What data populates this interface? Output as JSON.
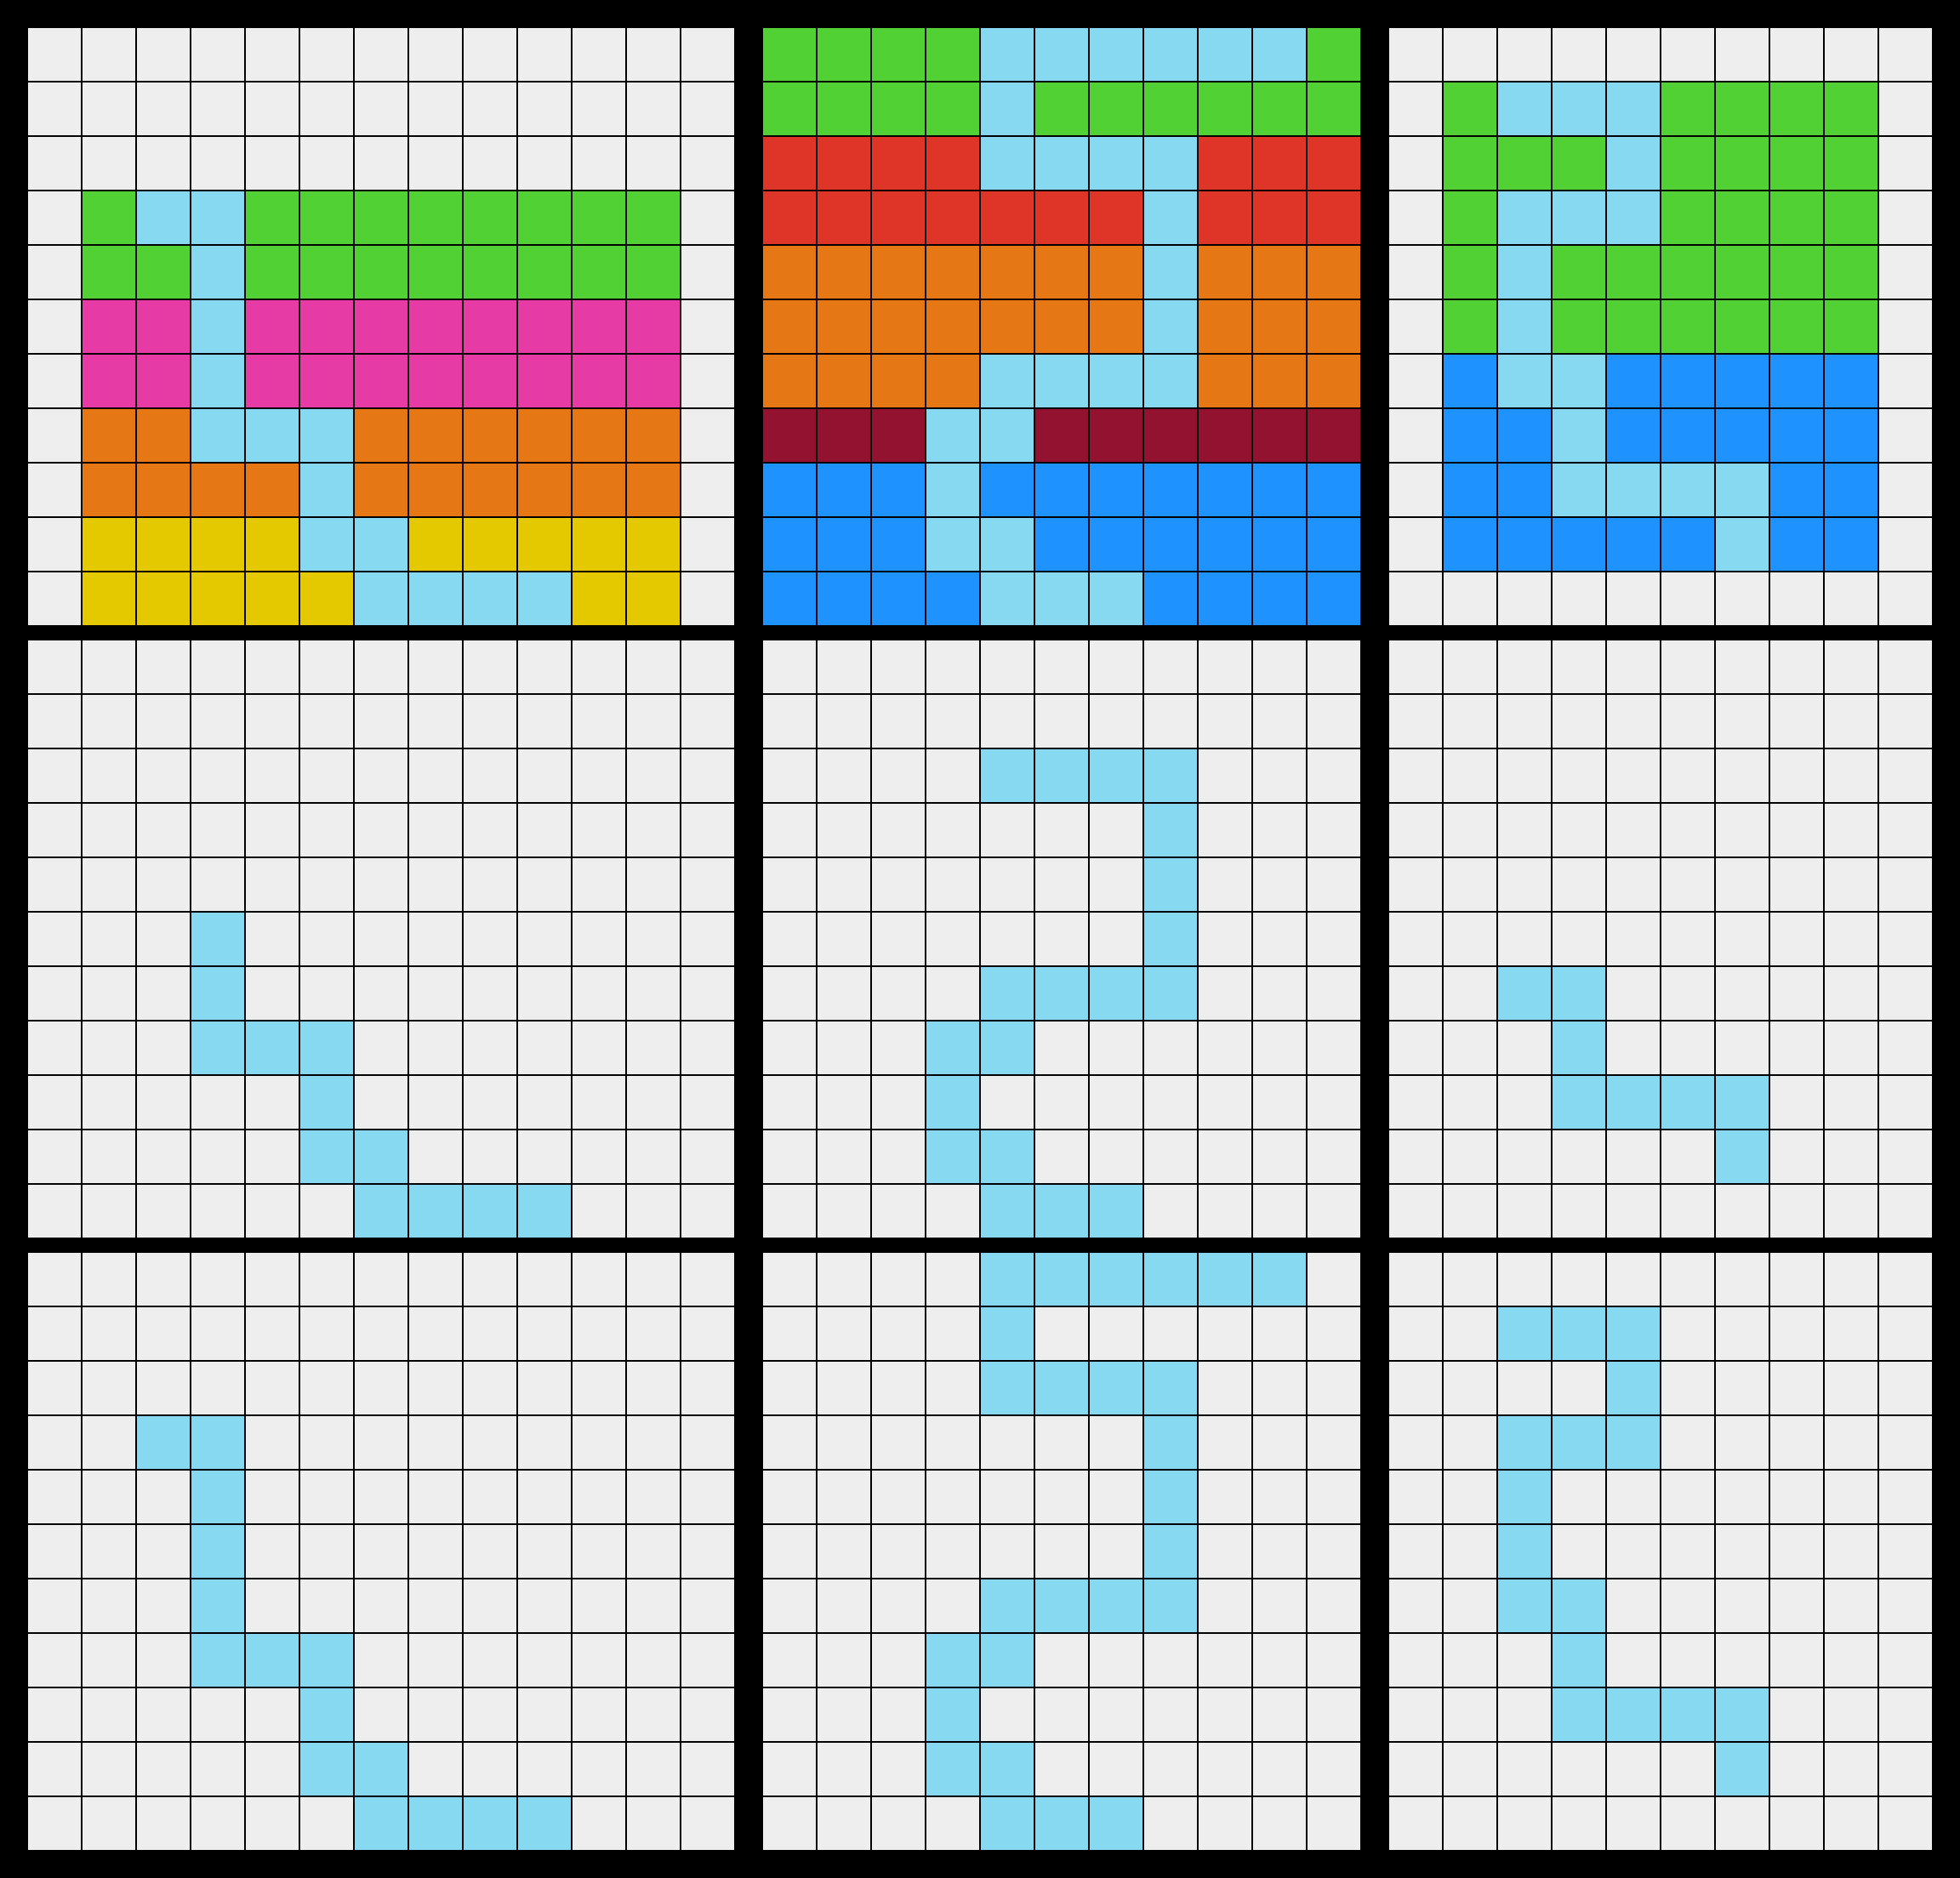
{
  "colors": {
    "0": "#EEEEEE",
    "1": "#51D133",
    "2": "#87D9F2",
    "3": "#E63BA4",
    "4": "#E57715",
    "5": "#E5C900",
    "6": "#DF3428",
    "7": "#921230",
    "8": "#1E92FF"
  },
  "panels": [
    {
      "name": "panel-r1-c1",
      "rows": 11,
      "cols": 13,
      "grid": [
        [
          0,
          0,
          0,
          0,
          0,
          0,
          0,
          0,
          0,
          0,
          0,
          0,
          0
        ],
        [
          0,
          0,
          0,
          0,
          0,
          0,
          0,
          0,
          0,
          0,
          0,
          0,
          0
        ],
        [
          0,
          0,
          0,
          0,
          0,
          0,
          0,
          0,
          0,
          0,
          0,
          0,
          0
        ],
        [
          0,
          1,
          2,
          2,
          1,
          1,
          1,
          1,
          1,
          1,
          1,
          1,
          0
        ],
        [
          0,
          1,
          1,
          2,
          1,
          1,
          1,
          1,
          1,
          1,
          1,
          1,
          0
        ],
        [
          0,
          3,
          3,
          2,
          3,
          3,
          3,
          3,
          3,
          3,
          3,
          3,
          0
        ],
        [
          0,
          3,
          3,
          2,
          3,
          3,
          3,
          3,
          3,
          3,
          3,
          3,
          0
        ],
        [
          0,
          4,
          4,
          2,
          2,
          2,
          4,
          4,
          4,
          4,
          4,
          4,
          0
        ],
        [
          0,
          4,
          4,
          4,
          4,
          2,
          4,
          4,
          4,
          4,
          4,
          4,
          0
        ],
        [
          0,
          5,
          5,
          5,
          5,
          2,
          2,
          5,
          5,
          5,
          5,
          5,
          0
        ],
        [
          0,
          5,
          5,
          5,
          5,
          5,
          2,
          2,
          2,
          2,
          5,
          5,
          0
        ]
      ]
    },
    {
      "name": "panel-r1-c2",
      "rows": 11,
      "cols": 11,
      "grid": [
        [
          1,
          1,
          1,
          1,
          2,
          2,
          2,
          2,
          2,
          2,
          1
        ],
        [
          1,
          1,
          1,
          1,
          2,
          1,
          1,
          1,
          1,
          1,
          1
        ],
        [
          6,
          6,
          6,
          6,
          2,
          2,
          2,
          2,
          6,
          6,
          6
        ],
        [
          6,
          6,
          6,
          6,
          6,
          6,
          6,
          2,
          6,
          6,
          6
        ],
        [
          4,
          4,
          4,
          4,
          4,
          4,
          4,
          2,
          4,
          4,
          4
        ],
        [
          4,
          4,
          4,
          4,
          4,
          4,
          4,
          2,
          4,
          4,
          4
        ],
        [
          4,
          4,
          4,
          4,
          2,
          2,
          2,
          2,
          4,
          4,
          4
        ],
        [
          7,
          7,
          7,
          2,
          2,
          7,
          7,
          7,
          7,
          7,
          7
        ],
        [
          8,
          8,
          8,
          2,
          8,
          8,
          8,
          8,
          8,
          8,
          8
        ],
        [
          8,
          8,
          8,
          2,
          2,
          8,
          8,
          8,
          8,
          8,
          8
        ],
        [
          8,
          8,
          8,
          8,
          2,
          2,
          2,
          8,
          8,
          8,
          8
        ]
      ]
    },
    {
      "name": "panel-r1-c3",
      "rows": 11,
      "cols": 10,
      "grid": [
        [
          0,
          0,
          0,
          0,
          0,
          0,
          0,
          0,
          0,
          0
        ],
        [
          0,
          1,
          2,
          2,
          2,
          1,
          1,
          1,
          1,
          0
        ],
        [
          0,
          1,
          1,
          1,
          2,
          1,
          1,
          1,
          1,
          0
        ],
        [
          0,
          1,
          2,
          2,
          2,
          1,
          1,
          1,
          1,
          0
        ],
        [
          0,
          1,
          2,
          1,
          1,
          1,
          1,
          1,
          1,
          0
        ],
        [
          0,
          1,
          2,
          1,
          1,
          1,
          1,
          1,
          1,
          0
        ],
        [
          0,
          8,
          2,
          2,
          8,
          8,
          8,
          8,
          8,
          0
        ],
        [
          0,
          8,
          8,
          2,
          8,
          8,
          8,
          8,
          8,
          0
        ],
        [
          0,
          8,
          8,
          2,
          2,
          2,
          2,
          8,
          8,
          0
        ],
        [
          0,
          8,
          8,
          8,
          8,
          8,
          2,
          8,
          8,
          0
        ],
        [
          0,
          0,
          0,
          0,
          0,
          0,
          0,
          0,
          0,
          0
        ]
      ]
    },
    {
      "name": "panel-r2-c1",
      "rows": 11,
      "cols": 13,
      "grid": [
        [
          0,
          0,
          0,
          0,
          0,
          0,
          0,
          0,
          0,
          0,
          0,
          0,
          0
        ],
        [
          0,
          0,
          0,
          0,
          0,
          0,
          0,
          0,
          0,
          0,
          0,
          0,
          0
        ],
        [
          0,
          0,
          0,
          0,
          0,
          0,
          0,
          0,
          0,
          0,
          0,
          0,
          0
        ],
        [
          0,
          0,
          0,
          0,
          0,
          0,
          0,
          0,
          0,
          0,
          0,
          0,
          0
        ],
        [
          0,
          0,
          0,
          0,
          0,
          0,
          0,
          0,
          0,
          0,
          0,
          0,
          0
        ],
        [
          0,
          0,
          0,
          2,
          0,
          0,
          0,
          0,
          0,
          0,
          0,
          0,
          0
        ],
        [
          0,
          0,
          0,
          2,
          0,
          0,
          0,
          0,
          0,
          0,
          0,
          0,
          0
        ],
        [
          0,
          0,
          0,
          2,
          2,
          2,
          0,
          0,
          0,
          0,
          0,
          0,
          0
        ],
        [
          0,
          0,
          0,
          0,
          0,
          2,
          0,
          0,
          0,
          0,
          0,
          0,
          0
        ],
        [
          0,
          0,
          0,
          0,
          0,
          2,
          2,
          0,
          0,
          0,
          0,
          0,
          0
        ],
        [
          0,
          0,
          0,
          0,
          0,
          0,
          2,
          2,
          2,
          2,
          0,
          0,
          0
        ]
      ]
    },
    {
      "name": "panel-r2-c2",
      "rows": 11,
      "cols": 11,
      "grid": [
        [
          0,
          0,
          0,
          0,
          0,
          0,
          0,
          0,
          0,
          0,
          0
        ],
        [
          0,
          0,
          0,
          0,
          0,
          0,
          0,
          0,
          0,
          0,
          0
        ],
        [
          0,
          0,
          0,
          0,
          2,
          2,
          2,
          2,
          0,
          0,
          0
        ],
        [
          0,
          0,
          0,
          0,
          0,
          0,
          0,
          2,
          0,
          0,
          0
        ],
        [
          0,
          0,
          0,
          0,
          0,
          0,
          0,
          2,
          0,
          0,
          0
        ],
        [
          0,
          0,
          0,
          0,
          0,
          0,
          0,
          2,
          0,
          0,
          0
        ],
        [
          0,
          0,
          0,
          0,
          2,
          2,
          2,
          2,
          0,
          0,
          0
        ],
        [
          0,
          0,
          0,
          2,
          2,
          0,
          0,
          0,
          0,
          0,
          0
        ],
        [
          0,
          0,
          0,
          2,
          0,
          0,
          0,
          0,
          0,
          0,
          0
        ],
        [
          0,
          0,
          0,
          2,
          2,
          0,
          0,
          0,
          0,
          0,
          0
        ],
        [
          0,
          0,
          0,
          0,
          2,
          2,
          2,
          0,
          0,
          0,
          0
        ]
      ]
    },
    {
      "name": "panel-r2-c3",
      "rows": 11,
      "cols": 10,
      "grid": [
        [
          0,
          0,
          0,
          0,
          0,
          0,
          0,
          0,
          0,
          0
        ],
        [
          0,
          0,
          0,
          0,
          0,
          0,
          0,
          0,
          0,
          0
        ],
        [
          0,
          0,
          0,
          0,
          0,
          0,
          0,
          0,
          0,
          0
        ],
        [
          0,
          0,
          0,
          0,
          0,
          0,
          0,
          0,
          0,
          0
        ],
        [
          0,
          0,
          0,
          0,
          0,
          0,
          0,
          0,
          0,
          0
        ],
        [
          0,
          0,
          0,
          0,
          0,
          0,
          0,
          0,
          0,
          0
        ],
        [
          0,
          0,
          2,
          2,
          0,
          0,
          0,
          0,
          0,
          0
        ],
        [
          0,
          0,
          0,
          2,
          0,
          0,
          0,
          0,
          0,
          0
        ],
        [
          0,
          0,
          0,
          2,
          2,
          2,
          2,
          0,
          0,
          0
        ],
        [
          0,
          0,
          0,
          0,
          0,
          0,
          2,
          0,
          0,
          0
        ],
        [
          0,
          0,
          0,
          0,
          0,
          0,
          0,
          0,
          0,
          0
        ]
      ]
    },
    {
      "name": "panel-r3-c1",
      "rows": 11,
      "cols": 13,
      "grid": [
        [
          0,
          0,
          0,
          0,
          0,
          0,
          0,
          0,
          0,
          0,
          0,
          0,
          0
        ],
        [
          0,
          0,
          0,
          0,
          0,
          0,
          0,
          0,
          0,
          0,
          0,
          0,
          0
        ],
        [
          0,
          0,
          0,
          0,
          0,
          0,
          0,
          0,
          0,
          0,
          0,
          0,
          0
        ],
        [
          0,
          0,
          2,
          2,
          0,
          0,
          0,
          0,
          0,
          0,
          0,
          0,
          0
        ],
        [
          0,
          0,
          0,
          2,
          0,
          0,
          0,
          0,
          0,
          0,
          0,
          0,
          0
        ],
        [
          0,
          0,
          0,
          2,
          0,
          0,
          0,
          0,
          0,
          0,
          0,
          0,
          0
        ],
        [
          0,
          0,
          0,
          2,
          0,
          0,
          0,
          0,
          0,
          0,
          0,
          0,
          0
        ],
        [
          0,
          0,
          0,
          2,
          2,
          2,
          0,
          0,
          0,
          0,
          0,
          0,
          0
        ],
        [
          0,
          0,
          0,
          0,
          0,
          2,
          0,
          0,
          0,
          0,
          0,
          0,
          0
        ],
        [
          0,
          0,
          0,
          0,
          0,
          2,
          2,
          0,
          0,
          0,
          0,
          0,
          0
        ],
        [
          0,
          0,
          0,
          0,
          0,
          0,
          2,
          2,
          2,
          2,
          0,
          0,
          0
        ]
      ]
    },
    {
      "name": "panel-r3-c2",
      "rows": 11,
      "cols": 11,
      "grid": [
        [
          0,
          0,
          0,
          0,
          2,
          2,
          2,
          2,
          2,
          2,
          0
        ],
        [
          0,
          0,
          0,
          0,
          2,
          0,
          0,
          0,
          0,
          0,
          0
        ],
        [
          0,
          0,
          0,
          0,
          2,
          2,
          2,
          2,
          0,
          0,
          0
        ],
        [
          0,
          0,
          0,
          0,
          0,
          0,
          0,
          2,
          0,
          0,
          0
        ],
        [
          0,
          0,
          0,
          0,
          0,
          0,
          0,
          2,
          0,
          0,
          0
        ],
        [
          0,
          0,
          0,
          0,
          0,
          0,
          0,
          2,
          0,
          0,
          0
        ],
        [
          0,
          0,
          0,
          0,
          2,
          2,
          2,
          2,
          0,
          0,
          0
        ],
        [
          0,
          0,
          0,
          2,
          2,
          0,
          0,
          0,
          0,
          0,
          0
        ],
        [
          0,
          0,
          0,
          2,
          0,
          0,
          0,
          0,
          0,
          0,
          0
        ],
        [
          0,
          0,
          0,
          2,
          2,
          0,
          0,
          0,
          0,
          0,
          0
        ],
        [
          0,
          0,
          0,
          0,
          2,
          2,
          2,
          0,
          0,
          0,
          0
        ]
      ]
    },
    {
      "name": "panel-r3-c3",
      "rows": 11,
      "cols": 10,
      "grid": [
        [
          0,
          0,
          0,
          0,
          0,
          0,
          0,
          0,
          0,
          0
        ],
        [
          0,
          0,
          2,
          2,
          2,
          0,
          0,
          0,
          0,
          0
        ],
        [
          0,
          0,
          0,
          0,
          2,
          0,
          0,
          0,
          0,
          0
        ],
        [
          0,
          0,
          2,
          2,
          2,
          0,
          0,
          0,
          0,
          0
        ],
        [
          0,
          0,
          2,
          0,
          0,
          0,
          0,
          0,
          0,
          0
        ],
        [
          0,
          0,
          2,
          0,
          0,
          0,
          0,
          0,
          0,
          0
        ],
        [
          0,
          0,
          2,
          2,
          0,
          0,
          0,
          0,
          0,
          0
        ],
        [
          0,
          0,
          0,
          2,
          0,
          0,
          0,
          0,
          0,
          0
        ],
        [
          0,
          0,
          0,
          2,
          2,
          2,
          2,
          0,
          0,
          0
        ],
        [
          0,
          0,
          0,
          0,
          0,
          0,
          2,
          0,
          0,
          0
        ],
        [
          0,
          0,
          0,
          0,
          0,
          0,
          0,
          0,
          0,
          0
        ]
      ]
    }
  ]
}
